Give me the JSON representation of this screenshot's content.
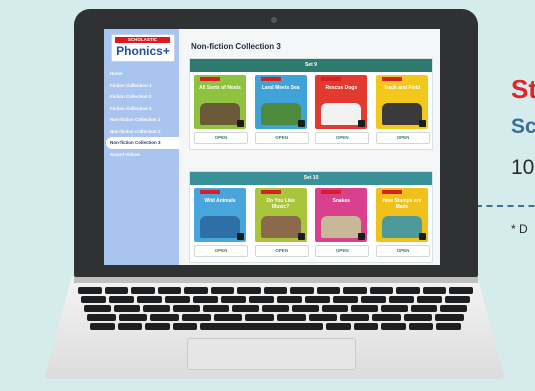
{
  "promo": {
    "headline": "St",
    "subheadline": "Sc",
    "count": "10",
    "footnote": "* D"
  },
  "app": {
    "logo_brand": "SCHOLASTIC",
    "logo_title": "Phonics+",
    "nav_items": [
      "Home",
      "Fiction Collection 1",
      "Fiction Collection 2",
      "Fiction Collection 3",
      "Non-fiction Collection 1",
      "Non-fiction Collection 2",
      "Non-fiction Collection 3",
      "Sound Videos"
    ],
    "active_nav_index": 6,
    "page_title": "Non-fiction Collection 3",
    "sets": [
      {
        "label": "Set 9",
        "header_color": "#2f7a6e",
        "books": [
          {
            "title": "All Sorts of Nests",
            "cover_color": "#8fc23f",
            "art_color": "#6a5a3a",
            "open_label": "OPEN"
          },
          {
            "title": "Land Meets Sea",
            "cover_color": "#3fa3d8",
            "art_color": "#4d8a3e",
            "open_label": "OPEN"
          },
          {
            "title": "Rescue Dogs",
            "cover_color": "#e23a2f",
            "art_color": "#f2f2f2",
            "open_label": "OPEN"
          },
          {
            "title": "Track and Field",
            "cover_color": "#f3c81d",
            "art_color": "#3a3a3a",
            "open_label": "OPEN"
          }
        ]
      },
      {
        "label": "Set 10",
        "header_color": "#3a9098",
        "books": [
          {
            "title": "Wild Animals",
            "cover_color": "#49a6dc",
            "art_color": "#2e6fa8",
            "open_label": "OPEN"
          },
          {
            "title": "Do You Like Music?",
            "cover_color": "#a9c63a",
            "art_color": "#8a6a4a",
            "open_label": "OPEN"
          },
          {
            "title": "Snakes",
            "cover_color": "#d9408d",
            "art_color": "#c9b79a",
            "open_label": "OPEN"
          },
          {
            "title": "How Stamps are Made",
            "cover_color": "#f0c01b",
            "art_color": "#4e9a9a",
            "open_label": "OPEN"
          }
        ]
      }
    ]
  },
  "colors": {
    "page_bg": "#d6ecec",
    "promo_red": "#e52227",
    "promo_blue": "#3a6f9b",
    "sidebar": "#a9c4ee"
  }
}
